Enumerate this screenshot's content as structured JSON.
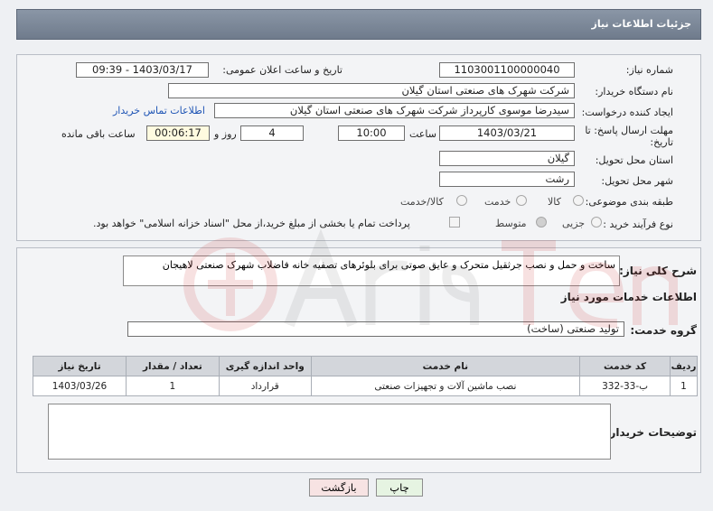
{
  "header": {
    "title": "جزئیات اطلاعات نیاز"
  },
  "info": {
    "need_number_label": "شماره نیاز:",
    "need_number": "1103001100000040",
    "announce_label": "تاریخ و ساعت اعلان عمومی:",
    "announce_value": "1403/03/17 - 09:39",
    "buyer_org_label": "نام دستگاه خریدار:",
    "buyer_org": "شرکت شهرک های صنعتی استان گیلان",
    "creator_label": "ایجاد کننده درخواست:",
    "creator": "سیدرضا موسوی کارپرداز  شرکت شهرک های صنعتی استان گیلان",
    "contact_link": "اطلاعات تماس خریدار",
    "deadline_label_1": "مهلت ارسال پاسخ: تا",
    "deadline_label_2": "تاریخ:",
    "deadline_date": "1403/03/21",
    "hour_label": "ساعت",
    "deadline_time": "10:00",
    "days_value": "4",
    "days_label": "روز و",
    "remaining_time": "00:06:17",
    "remaining_label": "ساعت باقی مانده",
    "province_label": "استان محل تحویل:",
    "province": "گیلان",
    "city_label": "شهر محل تحویل:",
    "city": "رشت",
    "category_label": "طبقه بندی موضوعی:",
    "category_options": [
      "کالا",
      "خدمت",
      "کالا/خدمت"
    ],
    "process_label": "نوع فرآیند خرید :",
    "process_options": [
      "جزیی",
      "متوسط"
    ],
    "treasury_note": "پرداخت تمام یا بخشی از مبلغ خرید،از محل \"اسناد خزانه اسلامی\" خواهد بود."
  },
  "details": {
    "summary_label": "شرح کلی نیاز:",
    "summary": "ساخت و حمل و نصب جرثقیل متحرک و عایق صوتی برای بلوئرهای تصفیه خانه فاضلاب شهرک صنعتی لاهیجان",
    "services_title": "اطلاعات خدمات مورد نیاز",
    "service_group_label": "گروه خدمت:",
    "service_group": "تولید صنعتی (ساخت)",
    "table": {
      "headers": [
        "ردیف",
        "کد خدمت",
        "نام خدمت",
        "واحد اندازه گیری",
        "تعداد / مقدار",
        "تاریخ نیاز"
      ],
      "rows": [
        [
          "1",
          "ب-33-332",
          "نصب ماشین آلات و تجهیزات صنعتی",
          "قرارداد",
          "1",
          "1403/03/26"
        ]
      ]
    },
    "buyer_notes_label": "توضیحات خریدار:",
    "buyer_notes": ""
  },
  "buttons": {
    "print": "چاپ",
    "back": "بازگشت"
  },
  "colors": {
    "header": "#7a8697",
    "link": "#1f55b5",
    "print_btn": "#e6f4e2",
    "back_btn": "#f7e3e3"
  }
}
